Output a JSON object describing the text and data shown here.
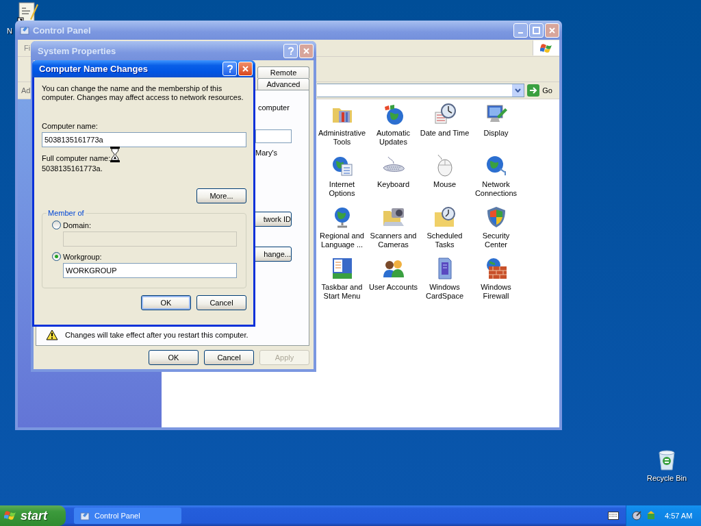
{
  "desktop_icons": [
    {
      "kind": "notepad",
      "label": "N"
    },
    {
      "kind": "recycle_bin",
      "label": "Recycle Bin"
    }
  ],
  "control_panel": {
    "title": "Control Panel",
    "menu_bar": [
      "Fi"
    ],
    "address_label": "Ad",
    "go_button": "Go",
    "items": [
      {
        "kind": "tools",
        "label": "Administrative Tools"
      },
      {
        "kind": "updates",
        "label": "Automatic Updates"
      },
      {
        "kind": "clock",
        "label": "Date and Time"
      },
      {
        "kind": "monitor",
        "label": "Display"
      },
      {
        "kind": "globe_list",
        "label": "Internet Options"
      },
      {
        "kind": "keyboard",
        "label": "Keyboard"
      },
      {
        "kind": "mouse",
        "label": "Mouse"
      },
      {
        "kind": "globe",
        "label": "Network Connections"
      },
      {
        "kind": "globe_stand",
        "label": "Regional and Language ..."
      },
      {
        "kind": "camera",
        "label": "Scanners and Cameras"
      },
      {
        "kind": "folder_clock",
        "label": "Scheduled Tasks"
      },
      {
        "kind": "shield",
        "label": "Security Center"
      },
      {
        "kind": "taskbar",
        "label": "Taskbar and Start Menu"
      },
      {
        "kind": "users",
        "label": "User Accounts"
      },
      {
        "kind": "card",
        "label": "Windows CardSpace"
      },
      {
        "kind": "firewall",
        "label": "Windows Firewall"
      }
    ]
  },
  "system_properties": {
    "title": "System Properties",
    "tabs": [
      {
        "label": "Remote",
        "selected": false
      },
      {
        "label": "Advanced",
        "selected": false
      }
    ],
    "partial_texts": [
      "computer",
      "Mary's"
    ],
    "partial_buttons": [
      "twork ID",
      "hange..."
    ],
    "notice": "Changes will take effect after you restart this computer.",
    "buttons": [
      {
        "label": "OK",
        "disabled": false
      },
      {
        "label": "Cancel",
        "disabled": false
      },
      {
        "label": "Apply",
        "disabled": true
      }
    ]
  },
  "computer_name_dialog": {
    "title": "Computer Name Changes",
    "intro": "You can change the name and the membership of this computer. Changes may affect access to network resources.",
    "computer_name_label": "Computer name:",
    "computer_name_value": "5038135161773a",
    "full_name_label": "Full computer name:",
    "full_name_value": "5038135161773a.",
    "more_button": "More...",
    "member_of": {
      "title": "Member of",
      "options": [
        {
          "label": "Domain:",
          "selected": false,
          "field": {
            "disabled": true
          }
        },
        {
          "label": "Workgroup:",
          "selected": true,
          "field": {
            "value": "WORKGROUP",
            "disabled": false
          }
        }
      ]
    },
    "buttons": [
      {
        "label": "OK",
        "default": true
      },
      {
        "label": "Cancel",
        "default": false
      }
    ]
  },
  "taskbar": {
    "start": "start",
    "tasks": [
      {
        "label": "Control Panel",
        "selected": false
      }
    ],
    "clock": "4:57 AM"
  }
}
